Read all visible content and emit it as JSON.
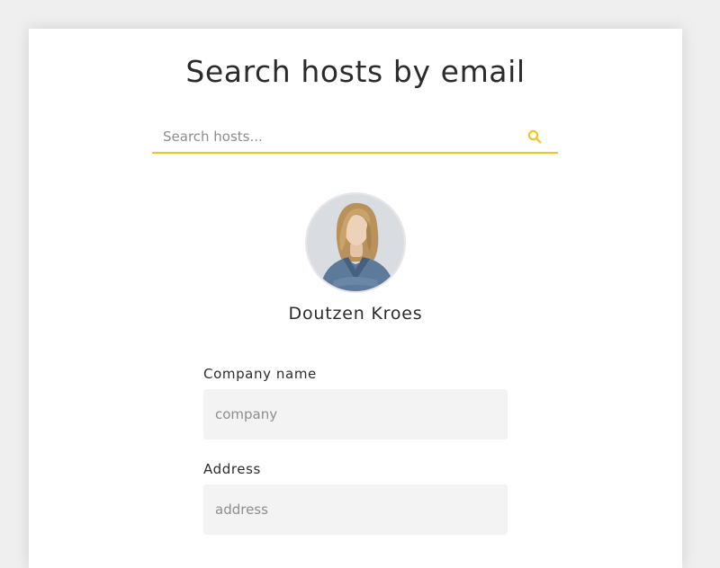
{
  "page": {
    "title": "Search hosts by email"
  },
  "search": {
    "placeholder": "Search hosts...",
    "value": "",
    "icon": "search-icon",
    "accent_color": "#f5c518"
  },
  "host": {
    "name": "Doutzen Kroes"
  },
  "form": {
    "fields": [
      {
        "label": "Company name",
        "placeholder": "company",
        "value": ""
      },
      {
        "label": "Address",
        "placeholder": "address",
        "value": ""
      }
    ]
  }
}
